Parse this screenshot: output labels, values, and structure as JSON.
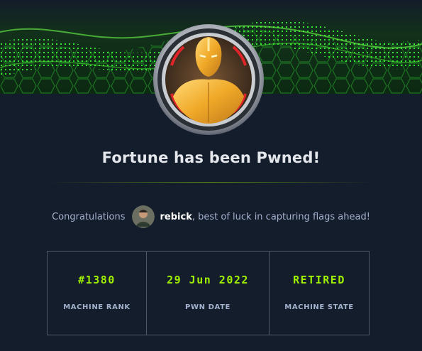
{
  "header": {
    "banner_icon": "green-hex-grid-banner",
    "machine_badge_icon": "fortune-machine-avatar"
  },
  "title": "Fortune has been Pwned!",
  "congrats": {
    "prefix": "Congratulations",
    "username": "rebick",
    "suffix": ", best of luck in capturing flags ahead!",
    "avatar_icon": "user-avatar"
  },
  "stats": [
    {
      "value": "#1380",
      "label": "MACHINE RANK"
    },
    {
      "value": "29 Jun 2022",
      "label": "PWN DATE"
    },
    {
      "value": "RETIRED",
      "label": "MACHINE STATE"
    }
  ],
  "colors": {
    "background": "#141d2b",
    "accent": "#9fef00",
    "label": "#a4b1cd",
    "border": "#4e5868"
  }
}
